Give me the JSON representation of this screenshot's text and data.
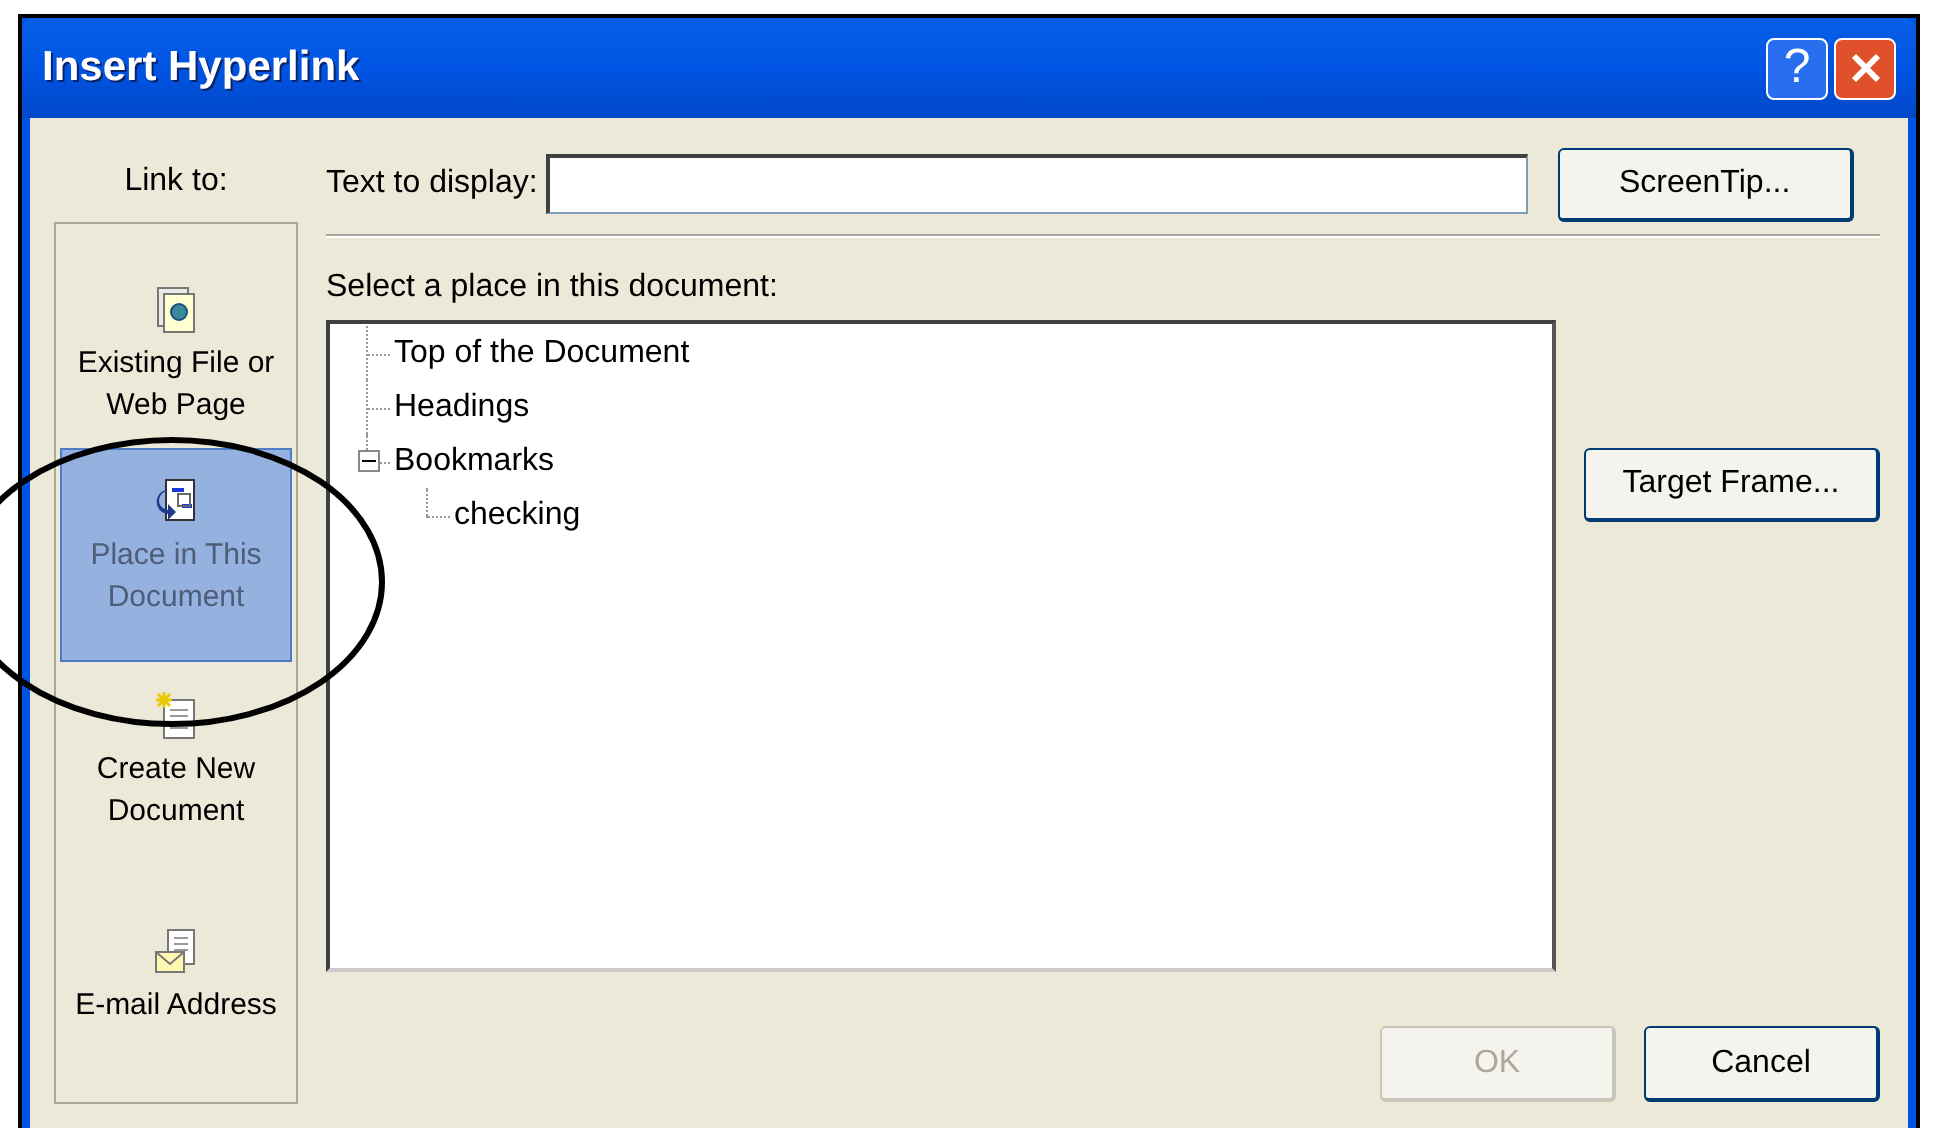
{
  "window": {
    "title": "Insert Hyperlink",
    "help_button": "?"
  },
  "link_to": {
    "label": "Link to:",
    "items": [
      {
        "kind": "file",
        "label": "Existing File or Web Page",
        "selected": false
      },
      {
        "kind": "place",
        "label": "Place in This Document",
        "selected": true
      },
      {
        "kind": "new",
        "label": "Create New Document",
        "selected": false
      },
      {
        "kind": "email",
        "label": "E-mail Address",
        "selected": false
      }
    ]
  },
  "text_to_display": {
    "label": "Text to display:"
  },
  "screentip_button": "ScreenTip...",
  "place_list": {
    "label": "Select a place in this document:",
    "tree": [
      {
        "label": "Top of the Document"
      },
      {
        "label": "Headings"
      },
      {
        "label": "Bookmarks",
        "expanded": true,
        "children": [
          {
            "label": "checking"
          }
        ]
      }
    ]
  },
  "target_frame_button": "Target Frame...",
  "buttons": [
    {
      "label": "OK",
      "disabled": true
    },
    {
      "label": "Cancel",
      "disabled": false
    }
  ]
}
